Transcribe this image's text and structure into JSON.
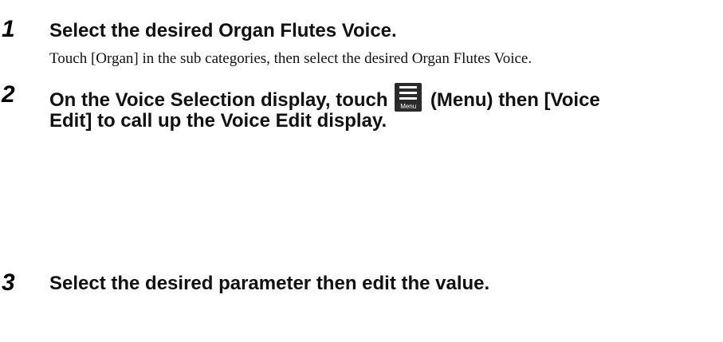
{
  "steps": [
    {
      "number": "1",
      "title": "Select the desired Organ Flutes Voice.",
      "body": "Touch [Organ] in the sub categories, then select the desired Organ Flutes Voice."
    },
    {
      "number": "2",
      "title_before_icon": "On the Voice Selection display, touch",
      "icon_name": "menu-icon",
      "icon_caption": "Menu",
      "title_after_icon": "(Menu) then [Voice",
      "title_line2": "Edit] to call up the Voice Edit display."
    },
    {
      "number": "3",
      "title": "Select the desired parameter then edit the value."
    }
  ]
}
